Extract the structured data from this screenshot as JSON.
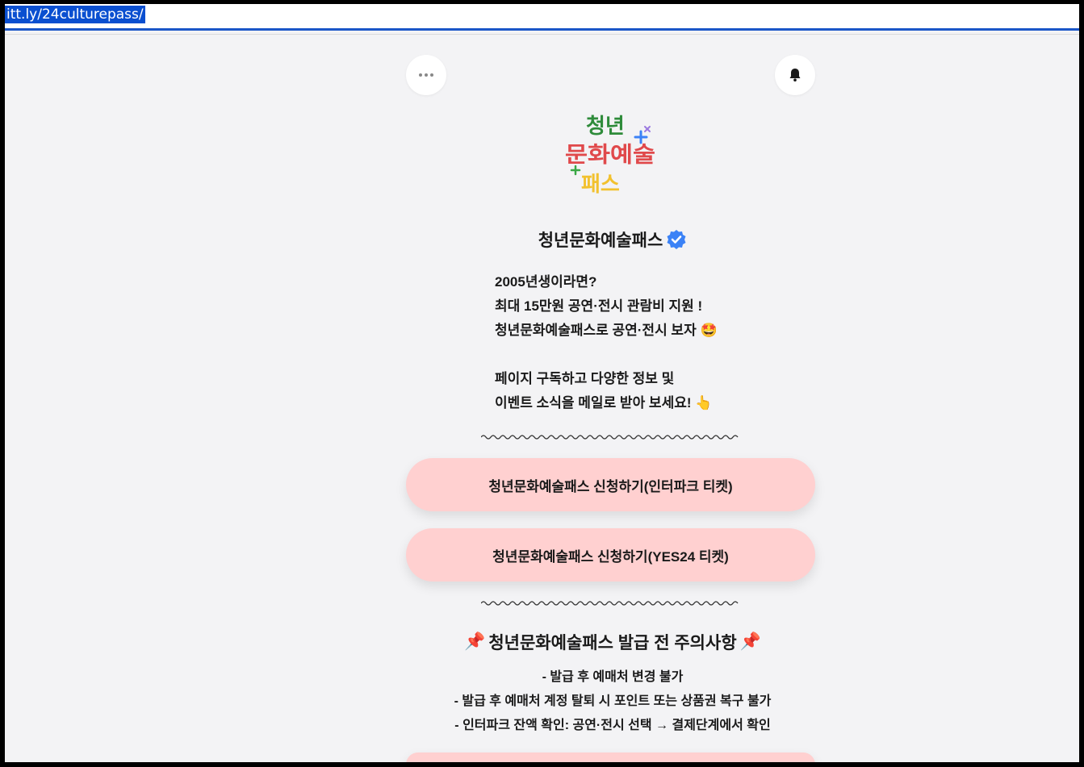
{
  "browser": {
    "url": "itt.ly/24culturepass/"
  },
  "toolbar": {
    "menu_icon": "more-dots-icon",
    "bell_icon": "bell-icon"
  },
  "profile": {
    "logo_lines": [
      "청년",
      "문화예술",
      "패스"
    ],
    "logo_colors": {
      "line1": "#2e8b3a",
      "line2": "#e0494b",
      "line3": "#f2c12e",
      "plus_blue": "#3b82f6",
      "plus_green": "#39a845",
      "cross_purple": "#9b7ae0"
    },
    "name": "청년문화예술패스",
    "verified_icon": "verified-badge-icon",
    "verified_color": "#3b82f6"
  },
  "description": {
    "line1": "2005년생이라면?",
    "line2": "최대 15만원 공연·전시 관람비 지원 !",
    "line3": "청년문화예술패스로 공연·전시 보자",
    "line3_emoji": "🤩",
    "line4": "페이지 구독하고 다양한 정보 및",
    "line5": "이벤트 소식을 메일로 받아 보세요!",
    "line5_emoji": "👆"
  },
  "links": [
    {
      "label": "청년문화예술패스 신청하기(인터파크 티켓)"
    },
    {
      "label": "청년문화예술패스 신청하기(YES24 티켓)"
    }
  ],
  "notice": {
    "pin": "📌",
    "title": "청년문화예술패스 발급 전 주의사항",
    "items": [
      "- 발급 후 예매처 변경 불가",
      "- 발급 후 예매처 계정 탈퇴 시 포인트 또는 상품권 복구 불가",
      "- 인터파크 잔액 확인: 공연·전시 선택 → 결제단계에서 확인"
    ]
  },
  "colors": {
    "button_bg": "#ffd0d0",
    "page_bg": "#f3f3f5",
    "url_highlight": "#0a4fd0"
  }
}
